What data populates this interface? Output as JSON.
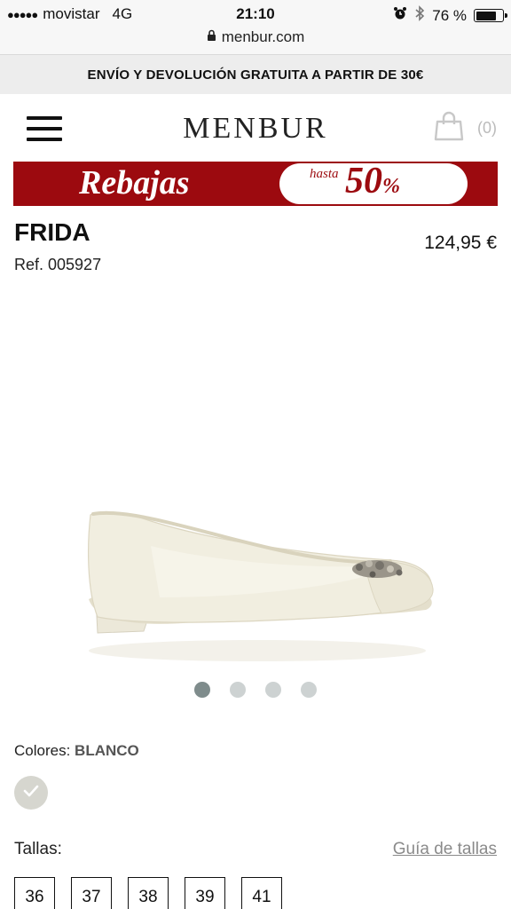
{
  "status_bar": {
    "signal": "●●●●●",
    "carrier": "movistar",
    "network": "4G",
    "time": "21:10",
    "battery": "76 %",
    "battery_level": 0.76,
    "url": "menbur.com"
  },
  "promo": {
    "text": "ENVÍO Y DEVOLUCIÓN GRATUITA A PARTIR DE 30€"
  },
  "header": {
    "logo": "MENBUR",
    "cart_count": "(0)"
  },
  "sale_banner": {
    "title": "Rebajas",
    "prefix": "hasta",
    "value": "50",
    "percent": "%",
    "colors": {
      "background": "#9c0a0f",
      "text": "#ffffff"
    }
  },
  "product": {
    "name": "FRIDA",
    "price": "124,95 €",
    "ref": "Ref. 005927"
  },
  "carousel": {
    "total": 4,
    "active_index": 0
  },
  "colors": {
    "label": "Colores:",
    "selected": "BLANCO"
  },
  "sizes": {
    "label": "Tallas:",
    "guide_link": "Guía de tallas",
    "options": [
      "36",
      "37",
      "38",
      "39",
      "41"
    ]
  }
}
